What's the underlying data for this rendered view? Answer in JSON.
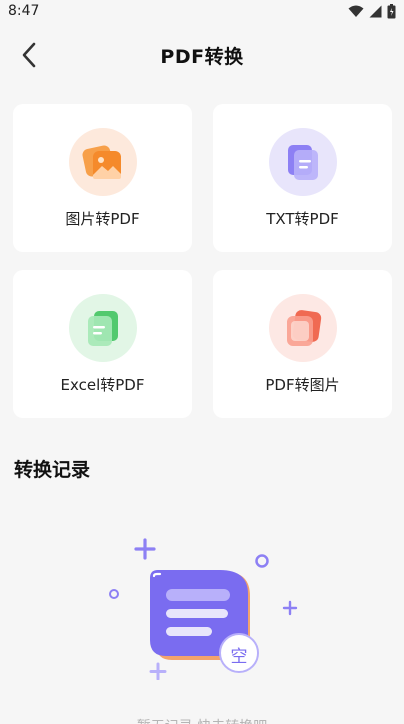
{
  "status_bar": {
    "time": "8:47"
  },
  "header": {
    "title": "PDF转换"
  },
  "converters": [
    {
      "label": "图片转PDF",
      "icon": "image-to-pdf-icon",
      "bg": "#fde9dc",
      "accent": "#f58a2b"
    },
    {
      "label": "TXT转PDF",
      "icon": "txt-to-pdf-icon",
      "bg": "#e8e5fb",
      "accent": "#7a6cf0"
    },
    {
      "label": "Excel转PDF",
      "icon": "excel-to-pdf-icon",
      "bg": "#e2f6e6",
      "accent": "#52c96e"
    },
    {
      "label": "PDF转图片",
      "icon": "pdf-to-image-icon",
      "bg": "#fde8e4",
      "accent": "#f06a52"
    }
  ],
  "history": {
    "title": "转换记录"
  },
  "empty_state": {
    "badge": "空",
    "text": "暂无记录 快去转换吧"
  },
  "colors": {
    "primary": "#7a6cf0",
    "background": "#f6f6f6"
  }
}
